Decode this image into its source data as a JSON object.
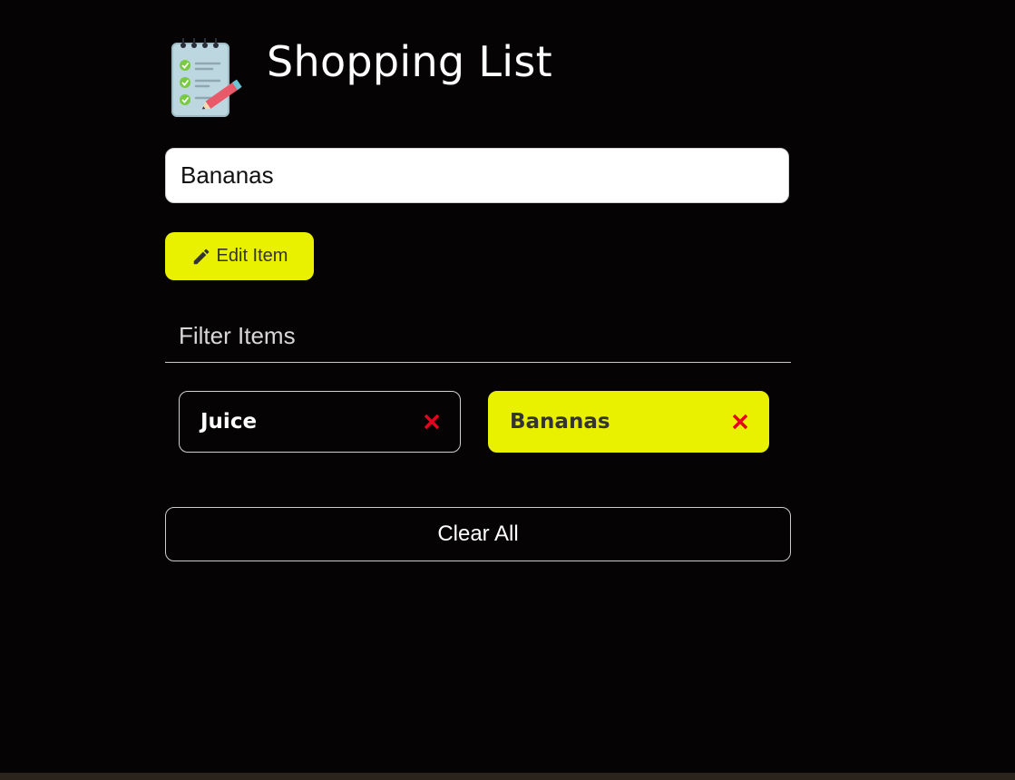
{
  "header": {
    "title": "Shopping List",
    "logo_icon": "notepad-checklist-icon"
  },
  "form": {
    "item_input_value": "Bananas",
    "edit_button_label": "Edit Item",
    "edit_button_icon": "pencil-icon"
  },
  "filter": {
    "placeholder": "Filter Items"
  },
  "items": [
    {
      "label": "Juice",
      "state": "normal",
      "remove_icon": "close-icon"
    },
    {
      "label": "Bananas",
      "state": "editing",
      "remove_icon": "close-icon"
    }
  ],
  "clear_button_label": "Clear All",
  "colors": {
    "background": "#050303",
    "accent": "#e9f000",
    "remove": "#e8001c",
    "text": "#ffffff"
  }
}
